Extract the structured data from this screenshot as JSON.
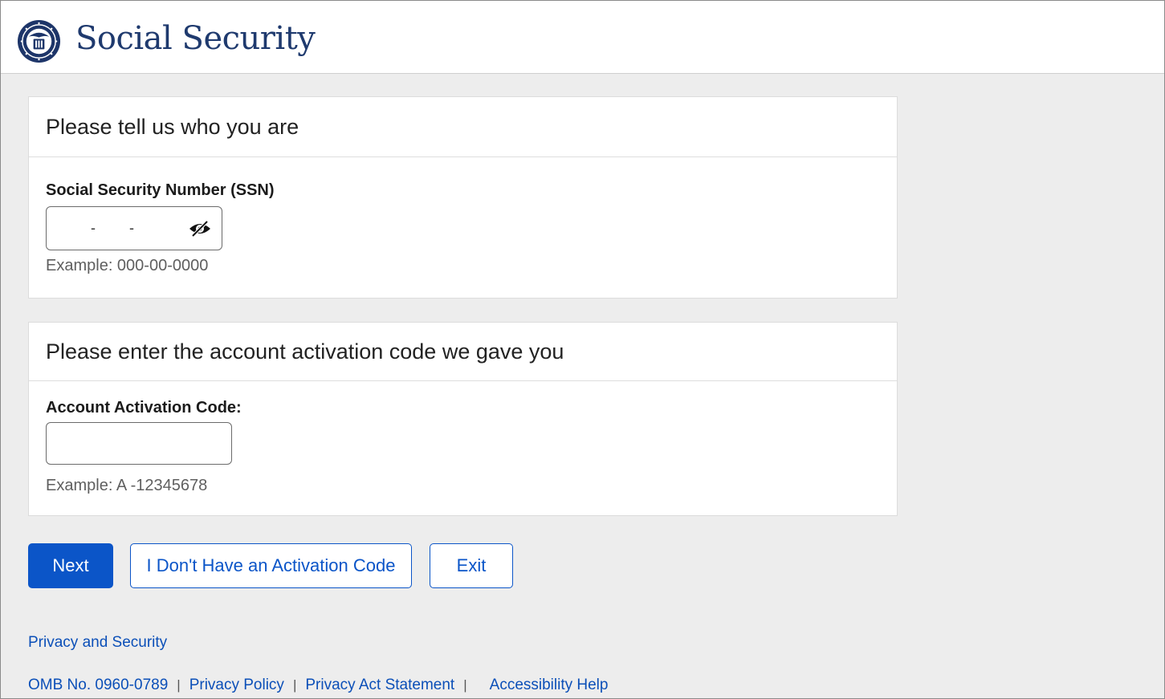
{
  "header": {
    "brand": "Social Security"
  },
  "identity_section": {
    "heading": "Please tell us who you are",
    "ssn_label": "Social Security Number (SSN)",
    "ssn_hint": "Example: 000-00-0000",
    "ssn_separator": "-"
  },
  "activation_section": {
    "heading": "Please enter the account activation code we gave you",
    "code_label": "Account Activation Code:",
    "code_value": "",
    "code_hint": "Example: A -12345678"
  },
  "actions": {
    "next": "Next",
    "no_code": "I Don't Have an Activation Code",
    "exit": "Exit"
  },
  "footer": {
    "privacy_security": "Privacy and Security",
    "omb": "OMB No. 0960-0789",
    "separator": "|",
    "privacy_policy": "Privacy Policy",
    "privacy_act": "Privacy Act Statement",
    "accessibility": "Accessibility Help"
  },
  "colors": {
    "brand": "#1f3a6e",
    "primary": "#0b55c8",
    "link": "#0b4fb8",
    "page_bg": "#ededed"
  },
  "icons": {
    "logo": "ssa-seal-icon",
    "reveal": "eye-slash-icon"
  }
}
